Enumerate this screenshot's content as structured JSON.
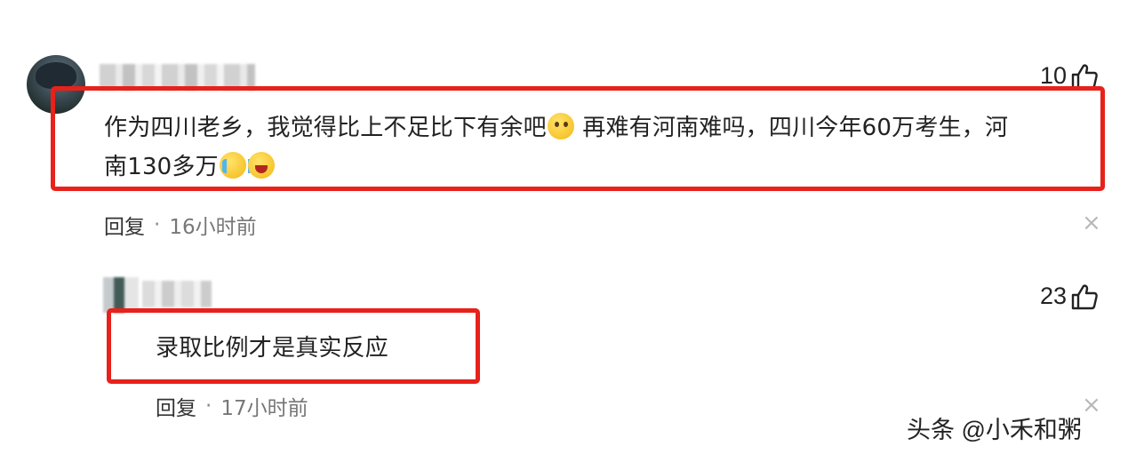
{
  "comments": [
    {
      "text_part1": "作为四川老乡，我觉得比上不足比下有余吧",
      "text_part2": " 再难有河南难吗，四川今年60万考生，河",
      "text_part3": "南130多万",
      "emoji_1": "thinking-face-icon",
      "emoji_2": "loudly-crying-face-icon",
      "emoji_3": "laughing-face-icon",
      "likes": "10",
      "reply_label": "回复",
      "separator": "·",
      "time": "16小时前",
      "close": "×"
    },
    {
      "text": "录取比例才是真实反应",
      "likes": "23",
      "reply_label": "回复",
      "separator": "·",
      "time": "17小时前",
      "close": "×"
    }
  ],
  "watermark": "头条 @小禾和粥",
  "colors": {
    "highlight_red": "#e8211b",
    "text": "#222222",
    "meta": "#777777",
    "close": "#b8b8b8"
  }
}
